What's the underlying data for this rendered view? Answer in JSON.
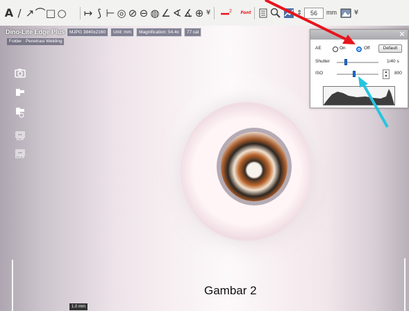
{
  "toolbar": {
    "text_tool": "A",
    "line_tool": "/",
    "arrow_tool": "↗",
    "curve_tool": "⌒",
    "rect_tool": "□",
    "ellipse_tool": "○",
    "hline_tool": "↦",
    "polyline_tool": "⟆",
    "parallel_tool": "⊢",
    "circle3_tool": "◎",
    "circle_tool": "⊘",
    "circle_center_tool": "⊖",
    "arc_tool": "◍",
    "angle_tool": "∠",
    "angle2_tool": "∢",
    "angle3_tool": "∡",
    "grid_tool": "⊕",
    "more_1": "¥",
    "font_label": "Font",
    "zoom_value": "56",
    "unit_label": "mm",
    "more_2": "¥"
  },
  "overlay": {
    "app_title": "Dino-Lite Edge Plus",
    "resolution": "MJPG 3840x2160",
    "unit": "Unit: mm",
    "magnification": "Magnification: 54.4x",
    "calibration": "77 cal",
    "folder": "Folder : Penetrasi Welding"
  },
  "side_toolbar": {
    "edr_caption": "EDR",
    "edof_caption": "EDOF"
  },
  "panel": {
    "ae_label": "AE",
    "on_label": "On",
    "off_label": "Off",
    "default_button": "Default",
    "shutter_label": "Shutter",
    "shutter_value": "1/40 s",
    "iso_label": "ISO",
    "iso_value": "800",
    "shutter_level": 0.22,
    "iso_level": 0.42,
    "ae_selected": "Off"
  },
  "scale_label": "1.0 mm",
  "caption": "Gambar 2",
  "colors": {
    "red_arrow": "#e8141c",
    "cyan_arrow": "#27c4e0",
    "accent": "#1e73d8"
  },
  "icons": {
    "camera": "camera-icon",
    "record": "video-record-icon",
    "timelapse": "timelapse-icon",
    "edr": "edr-icon",
    "edof": "edof-icon",
    "close": "close-icon"
  }
}
